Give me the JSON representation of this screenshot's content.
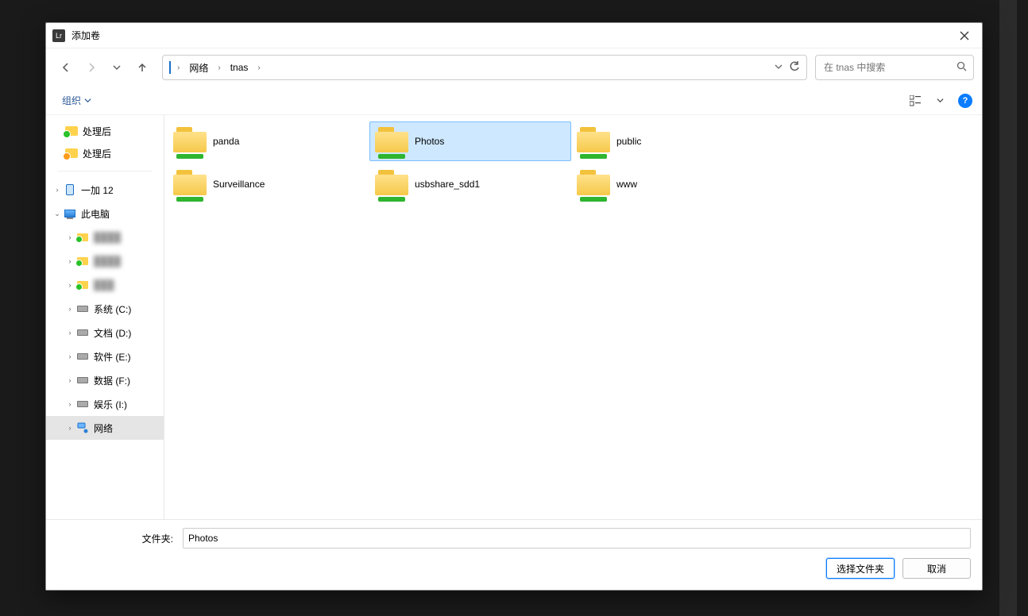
{
  "window": {
    "app_badge": "Lr",
    "title": "添加卷",
    "close_tooltip": "关闭"
  },
  "nav": {
    "back": "←",
    "forward": "→",
    "recent": "⌄",
    "up": "↑"
  },
  "breadcrumb": {
    "root_label": "网络",
    "items": [
      "网络",
      "tnas"
    ]
  },
  "address_controls": {
    "dropdown": "⌄",
    "refresh": "⟳"
  },
  "search": {
    "placeholder": "在 tnas 中搜索"
  },
  "toolbar": {
    "organize": "组织",
    "view_tooltip": "更改视图",
    "help": "?"
  },
  "sidebar": {
    "quick": [
      {
        "label": "处理后"
      },
      {
        "label": "处理后"
      }
    ],
    "tree": [
      {
        "label": "一加 12",
        "icon": "phone",
        "indent": 0,
        "twist": ">"
      },
      {
        "label": "此电脑",
        "icon": "pc",
        "indent": 0,
        "twist": "v"
      },
      {
        "label": "████",
        "icon": "folder-green",
        "indent": 2,
        "twist": ">",
        "blurred": true
      },
      {
        "label": "████",
        "icon": "folder-green",
        "indent": 2,
        "twist": ">",
        "blurred": true
      },
      {
        "label": "███",
        "icon": "folder-green",
        "indent": 2,
        "twist": ">",
        "blurred": true
      },
      {
        "label": "系统 (C:)",
        "icon": "drive",
        "indent": 2,
        "twist": ">"
      },
      {
        "label": "文档 (D:)",
        "icon": "drive",
        "indent": 2,
        "twist": ">"
      },
      {
        "label": "软件 (E:)",
        "icon": "drive",
        "indent": 2,
        "twist": ">"
      },
      {
        "label": "数据 (F:)",
        "icon": "drive",
        "indent": 2,
        "twist": ">"
      },
      {
        "label": "娱乐 (I:)",
        "icon": "drive",
        "indent": 2,
        "twist": ">"
      },
      {
        "label": "网络",
        "icon": "network",
        "indent": 1,
        "twist": ">",
        "selected": true
      }
    ]
  },
  "items": [
    {
      "label": "panda",
      "selected": false
    },
    {
      "label": "Photos",
      "selected": true
    },
    {
      "label": "public",
      "selected": false
    },
    {
      "label": "Surveillance",
      "selected": false
    },
    {
      "label": "usbshare_sdd1",
      "selected": false
    },
    {
      "label": "www",
      "selected": false
    }
  ],
  "footer": {
    "label": "文件夹:",
    "value": "Photos",
    "select": "选择文件夹",
    "cancel": "取消"
  }
}
